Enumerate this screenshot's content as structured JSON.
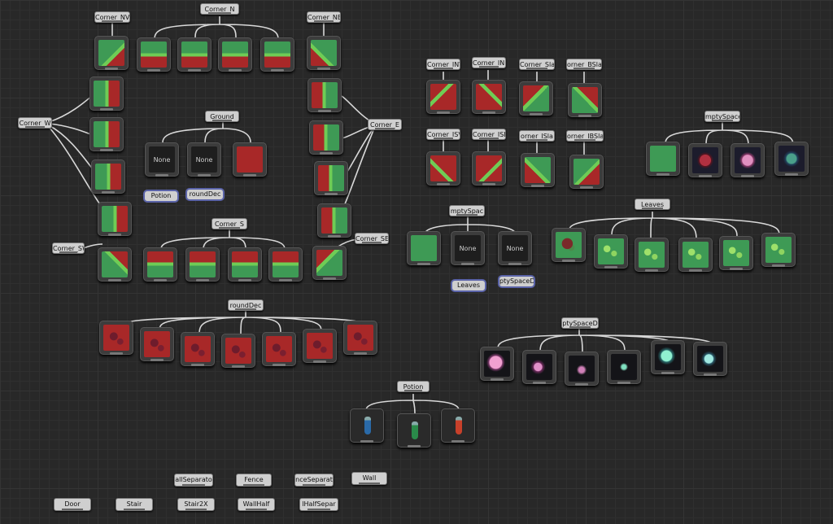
{
  "groups": {
    "corner_n": "Corner_N",
    "corner_nw": "Corner_NV",
    "corner_ne": "Corner_NE",
    "corner_w": "Corner_W",
    "corner_e": "Corner_E",
    "corner_s": "Corner_S",
    "corner_sw": "Corner_SW",
    "corner_se": "Corner_SE",
    "ground": "Ground",
    "ground_dec": "roundDec",
    "empty_space": "mptySpace",
    "empty_space_2": "mptySpac",
    "empty_space_d": "ptySpaceD",
    "leaves": "Leaves",
    "potion": "Potion",
    "corner_inw": "Corner_INV",
    "corner_ine": "Corner_INE",
    "corner_slas": "Corner_Slas",
    "corner_bsla": "orner_BSla",
    "corner_isw": "Corner_ISV",
    "corner_ise": "Corner_ISE",
    "corner_isla": "orner_ISla",
    "corner_ibsl": "orner_IBSla"
  },
  "none_label": "None",
  "refs": {
    "potion": "Potion",
    "ground_dec": "roundDec",
    "leaves": "Leaves",
    "empty_space_d": "ptySpaceD"
  },
  "buttons": {
    "wall_separator": "allSeparato",
    "fence": "Fence",
    "fence_separator": "nceSeparat",
    "wall": "Wall",
    "door": "Door",
    "stair": "Stair",
    "stair2x": "Stair2X",
    "wall_half": "WallHalf",
    "wall_half_separator": "lHalfSepar"
  },
  "colors": {
    "grass": "#3e9a55",
    "dirt": "#a82828",
    "leaf_edge": "#6fcc55",
    "canvas": "#282828",
    "ref_border": "#5a63a8"
  }
}
